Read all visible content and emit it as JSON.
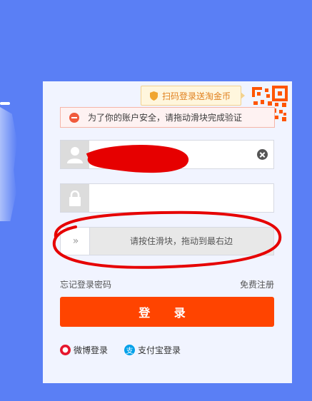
{
  "qr_tip": {
    "text": "扫码登录送淘金币"
  },
  "warning": {
    "text": "为了你的账户安全，请拖动滑块完成验证"
  },
  "username": {
    "value": ""
  },
  "password": {
    "value": ""
  },
  "slider": {
    "handle_glyph": "»",
    "text": "请按住滑块，拖动到最右边"
  },
  "links": {
    "forgot": "忘记登录密码",
    "register": "免费注册"
  },
  "login_button": {
    "label": "登 录"
  },
  "social": {
    "weibo": "微博登录",
    "alipay": "支付宝登录"
  },
  "colors": {
    "page_bg": "#5a7ff5",
    "panel_bg": "#f1f4ff",
    "accent": "#ff4400",
    "annotation": "#e60000"
  }
}
